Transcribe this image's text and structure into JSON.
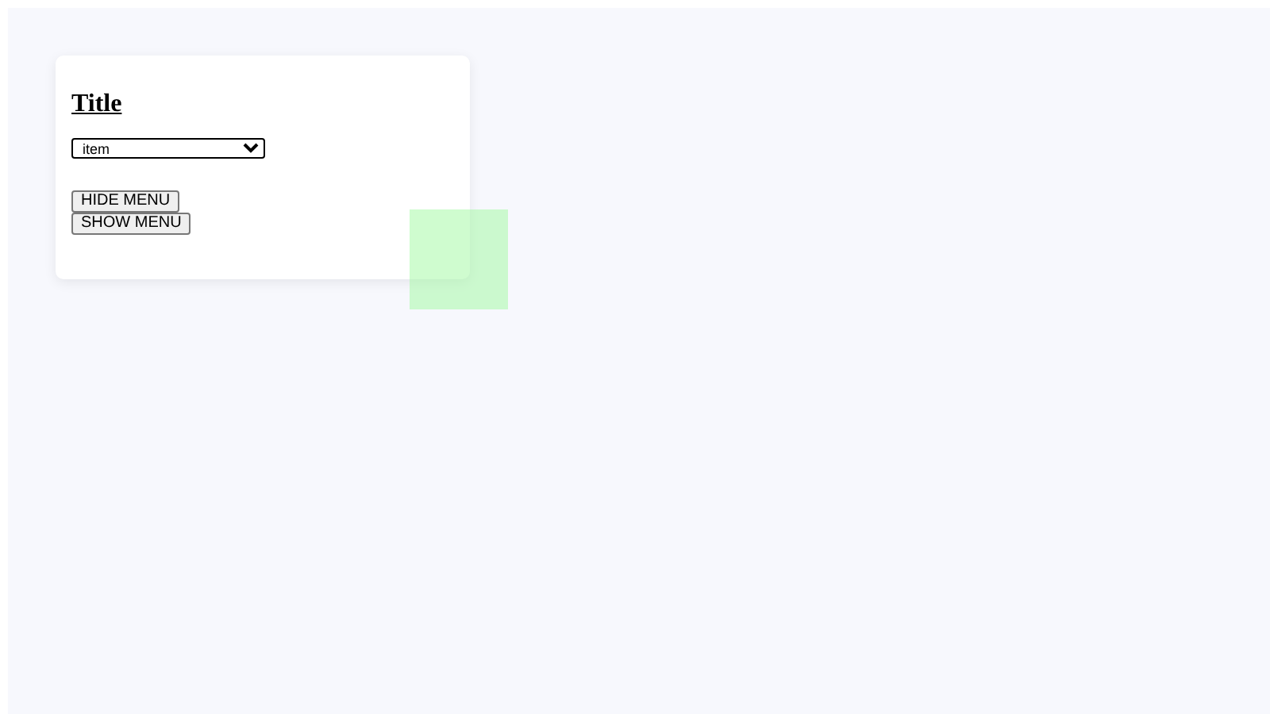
{
  "card": {
    "title": "Title",
    "dropdown": {
      "value": "item"
    },
    "buttons": [
      "HIDE MENU",
      "SHOW MENU"
    ]
  }
}
